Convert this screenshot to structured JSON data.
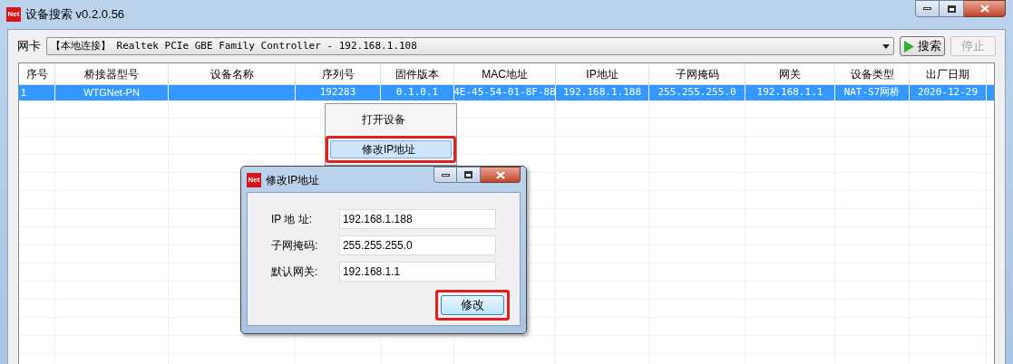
{
  "window": {
    "logo": "Net",
    "title": "设备搜索 v0.2.0.56"
  },
  "nic": {
    "label": "网卡",
    "value": "【本地连接】 Realtek PCIe GBE Family Controller - 192.168.1.108"
  },
  "buttons": [
    {
      "label": "搜索",
      "disabled": false
    },
    {
      "label": "停止",
      "disabled": true
    }
  ],
  "table": {
    "columns": [
      "序号",
      "桥接器型号",
      "设备名称",
      "序列号",
      "固件版本",
      "MAC地址",
      "IP地址",
      "子网掩码",
      "网关",
      "设备类型",
      "出厂日期"
    ],
    "rows": [
      {
        "selected": true,
        "cells": [
          "1",
          "WTGNet-PN",
          "",
          "192283",
          "0.1.0.1",
          "4E-45-54-01-8F-8B",
          "192.168.1.188",
          "255.255.255.0",
          "192.168.1.1",
          "NAT-S7网桥",
          "2020-12-29"
        ]
      }
    ]
  },
  "context_menu": [
    {
      "label": "打开设备",
      "selected": false,
      "highlighted": false
    },
    {
      "label": "修改IP地址",
      "selected": true,
      "highlighted": true
    }
  ],
  "dialog": {
    "logo": "Net",
    "title": "修改IP地址",
    "fields": [
      {
        "label": "IP 地 址:",
        "value": "192.168.1.188"
      },
      {
        "label": "子网掩码:",
        "value": "255.255.255.0"
      },
      {
        "label": "默认网关:",
        "value": "192.168.1.1"
      }
    ],
    "button": {
      "label": "修改",
      "highlighted": true
    }
  }
}
